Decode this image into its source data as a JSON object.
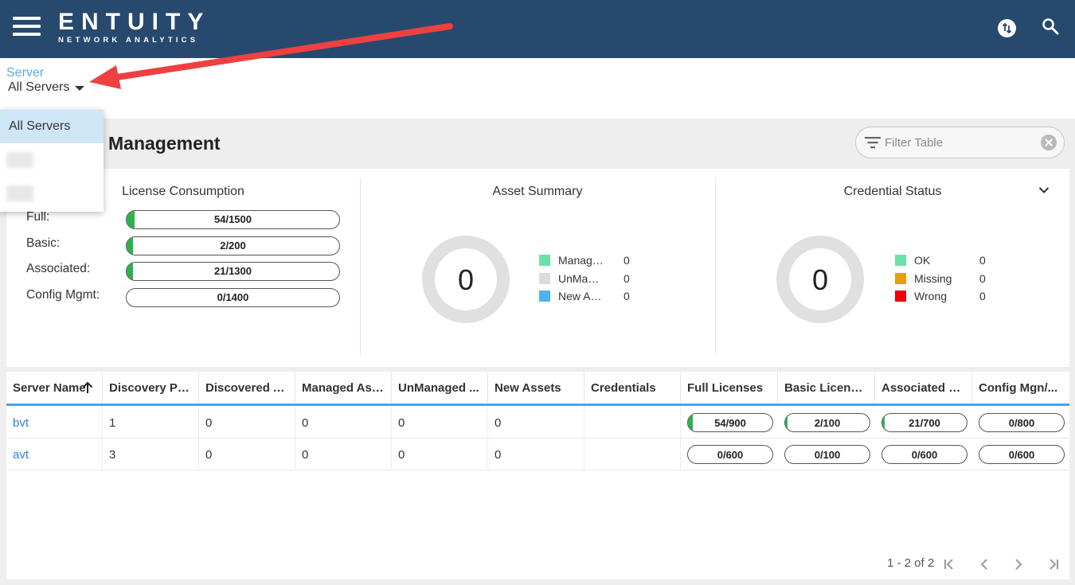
{
  "header": {
    "logo_main": "ENTUITY",
    "logo_sub": "NETWORK ANALYTICS",
    "menu_icon": "hamburger-menu-icon",
    "sync_icon": "sync-icon",
    "search_icon": "search-icon",
    "background_color": "#27496e"
  },
  "server_selector": {
    "label": "Server",
    "value": "All Servers",
    "options": [
      "All Servers",
      "",
      ""
    ]
  },
  "page": {
    "title": "Management",
    "filter_placeholder": "Filter Table"
  },
  "license_consumption": {
    "title": "License Consumption",
    "rows": [
      {
        "label": "Full:",
        "text": "54/1500",
        "used": 54,
        "total": 1500
      },
      {
        "label": "Basic:",
        "text": "2/200",
        "used": 2,
        "total": 200
      },
      {
        "label": "Associated:",
        "text": "21/1300",
        "used": 21,
        "total": 1300
      },
      {
        "label": "Config Mgmt:",
        "text": "0/1400",
        "used": 0,
        "total": 1400
      }
    ]
  },
  "asset_summary": {
    "title": "Asset Summary",
    "total": "0",
    "legend": [
      {
        "name": "Manag…",
        "value": "0",
        "color": "#6ee0a8"
      },
      {
        "name": "UnMa…",
        "value": "0",
        "color": "#dcdcdc"
      },
      {
        "name": "New A…",
        "value": "0",
        "color": "#4db2ef"
      }
    ]
  },
  "credential_status": {
    "title": "Credential Status",
    "total": "0",
    "legend": [
      {
        "name": "OK",
        "value": "0",
        "color": "#6ee0a8"
      },
      {
        "name": "Missing",
        "value": "0",
        "color": "#e5a010"
      },
      {
        "name": "Wrong",
        "value": "0",
        "color": "#f00000"
      }
    ]
  },
  "table": {
    "columns": [
      "Server Name",
      "Discovery Pro...",
      "Discovered A...",
      "Managed Ass...",
      "UnManaged ...",
      "New Assets",
      "Credentials",
      "Full Licenses",
      "Basic Licenses",
      "Associated Li...",
      "Config Mgn/..."
    ],
    "rows": [
      {
        "server": "bvt",
        "discovery": "1",
        "discovered": "0",
        "managed": "0",
        "unmanaged": "0",
        "new_assets": "0",
        "credentials": "",
        "full": {
          "text": "54/900",
          "used": 54,
          "total": 900
        },
        "basic": {
          "text": "2/100",
          "used": 2,
          "total": 100
        },
        "associated": {
          "text": "21/700",
          "used": 21,
          "total": 700
        },
        "config": {
          "text": "0/800",
          "used": 0,
          "total": 800
        }
      },
      {
        "server": "avt",
        "discovery": "3",
        "discovered": "0",
        "managed": "0",
        "unmanaged": "0",
        "new_assets": "0",
        "credentials": "",
        "full": {
          "text": "0/600",
          "used": 0,
          "total": 600
        },
        "basic": {
          "text": "0/100",
          "used": 0,
          "total": 100
        },
        "associated": {
          "text": "0/600",
          "used": 0,
          "total": 600
        },
        "config": {
          "text": "0/600",
          "used": 0,
          "total": 600
        }
      }
    ],
    "pagination": "1 - 2 of 2"
  },
  "colors": {
    "accent": "#4aa3e8",
    "link": "#2f86d8",
    "progress": "#2bb24c",
    "annotation_arrow": "#ef4040"
  }
}
